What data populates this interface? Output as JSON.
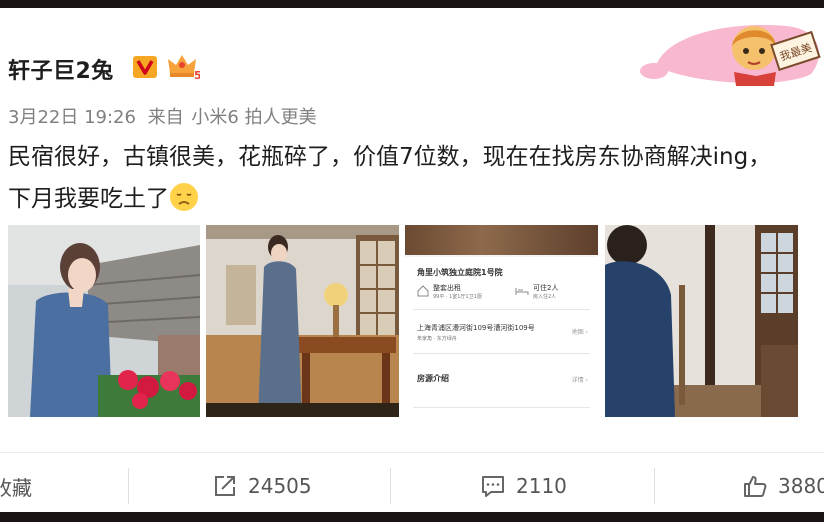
{
  "post": {
    "username": "轩子巨2兔",
    "badges": [
      "verified-v-icon",
      "vip-crown-5-icon"
    ],
    "vip_level": "5",
    "date": "3月22日 19:26",
    "source_prefix": "来自",
    "source": "小米6 拍人更美",
    "text_line1": "民宿很好，古镇很美，花瓶碎了，价值7位数，现在在找房东协商解决ing，",
    "text_line2": "下月我要吃土了",
    "emoji": "sad-face-emoji",
    "deco_label": "我最美"
  },
  "listing": {
    "title": "角里小筑独立庭院1号院",
    "feature1": "整套出租",
    "feature1_sub": "99平 · 1室1厅1卫1厨",
    "feature2": "可住2人",
    "feature2_sub": "房入住2人",
    "address": "上海青浦区漕河街109号漕河街109号",
    "address_sub": "朱家角 · 东方绿舟",
    "map_link": "地图 ›",
    "section": "房源介绍",
    "detail_link": "详情 ›"
  },
  "actions": {
    "favorite_label": "收藏",
    "repost_count": "24505",
    "comment_count": "2110",
    "like_count": "3880"
  },
  "colors": {
    "verified": "#f5a623",
    "text": "#1e1e1e",
    "meta": "#808080",
    "deco_pink": "#f7a9c4"
  }
}
